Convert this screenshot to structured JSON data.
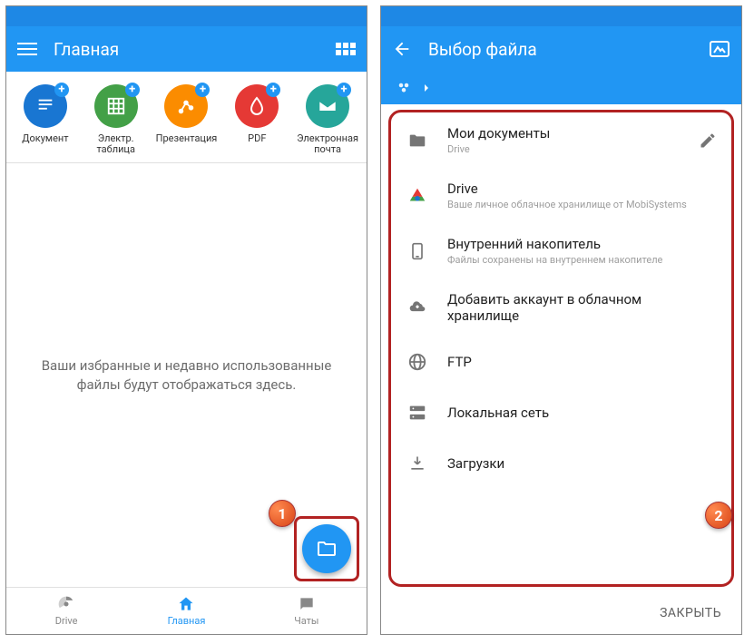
{
  "left": {
    "title": "Главная",
    "create": [
      {
        "label": "Документ"
      },
      {
        "label": "Электр. таблица"
      },
      {
        "label": "Презентация"
      },
      {
        "label": "PDF"
      },
      {
        "label": "Электронная почта"
      }
    ],
    "empty_line1": "Ваши избранные и недавно использованные",
    "empty_line2": "файлы будут отображаться здесь.",
    "nav": {
      "drive": "Drive",
      "home": "Главная",
      "chats": "Чаты"
    }
  },
  "right": {
    "title": "Выбор файла",
    "locations": [
      {
        "title": "Мои документы",
        "sub": "Drive",
        "edit": true
      },
      {
        "title": "Drive",
        "sub": "Ваше личное облачное хранилище от MobiSystems"
      },
      {
        "title": "Внутренний накопитель",
        "sub": "Файлы сохранены на внутреннем накопителе"
      },
      {
        "title": "Добавить аккаунт в облачном хранилище"
      },
      {
        "title": "FTP"
      },
      {
        "title": "Локальная сеть"
      },
      {
        "title": "Загрузки"
      }
    ],
    "close": "ЗАКРЫТЬ"
  },
  "badges": {
    "b1": "1",
    "b2": "2"
  }
}
